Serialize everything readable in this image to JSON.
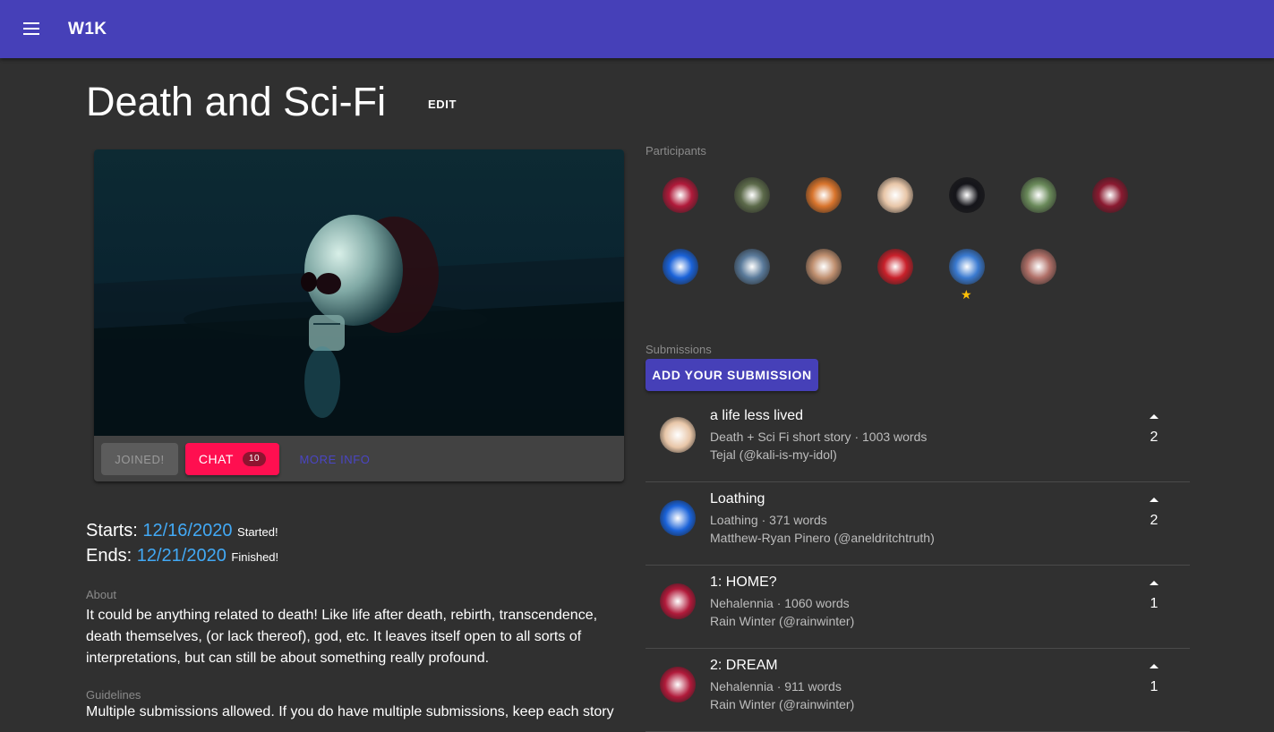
{
  "app": {
    "title": "W1K"
  },
  "page": {
    "title": "Death and Sci-Fi",
    "edit_label": "EDIT"
  },
  "card": {
    "joined_label": "JOINED!",
    "chat_label": "CHAT",
    "chat_count": "10",
    "more_info_label": "MORE INFO"
  },
  "dates": {
    "starts_label": "Starts:",
    "starts_value": "12/16/2020",
    "starts_status": "Started!",
    "ends_label": "Ends:",
    "ends_value": "12/21/2020",
    "ends_status": "Finished!"
  },
  "about": {
    "label": "About",
    "text": "It could be anything related to death! Like life after death, rebirth, transcendence, death themselves, (or lack thereof), god, etc. It leaves itself open to all sorts of interpretations, but can still be about something really profound."
  },
  "guidelines": {
    "label": "Guidelines",
    "text": "Multiple submissions allowed. If you do have multiple submissions, keep each story"
  },
  "participants": {
    "label": "Participants",
    "star_icon": "star-icon",
    "colors": [
      "#b01a3a",
      "#5c6a4a",
      "#d8742c",
      "#e8c6a8",
      "#15151a",
      "#6a8a5a",
      "#8a1a30",
      "#1a62d8",
      "#5a7a9a",
      "#c09070",
      "#c8202a",
      "#3a7ad0",
      "#b07068"
    ]
  },
  "submissions": {
    "label": "Submissions",
    "add_label": "ADD YOUR SUBMISSION",
    "items": [
      {
        "title": "a life less lived",
        "meta": "Death + Sci Fi short story · 1003 words",
        "author": "Tejal (@kali-is-my-idol)",
        "votes": "2"
      },
      {
        "title": "Loathing",
        "meta": "Loathing · 371 words",
        "author": "Matthew-Ryan Pinero (@aneldritchtruth)",
        "votes": "2"
      },
      {
        "title": "1: HOME?",
        "meta": "Nehalennia · 1060 words",
        "author": "Rain Winter (@rainwinter)",
        "votes": "1"
      },
      {
        "title": "2: DREAM",
        "meta": "Nehalennia · 911 words",
        "author": "Rain Winter (@rainwinter)",
        "votes": "1"
      }
    ]
  }
}
